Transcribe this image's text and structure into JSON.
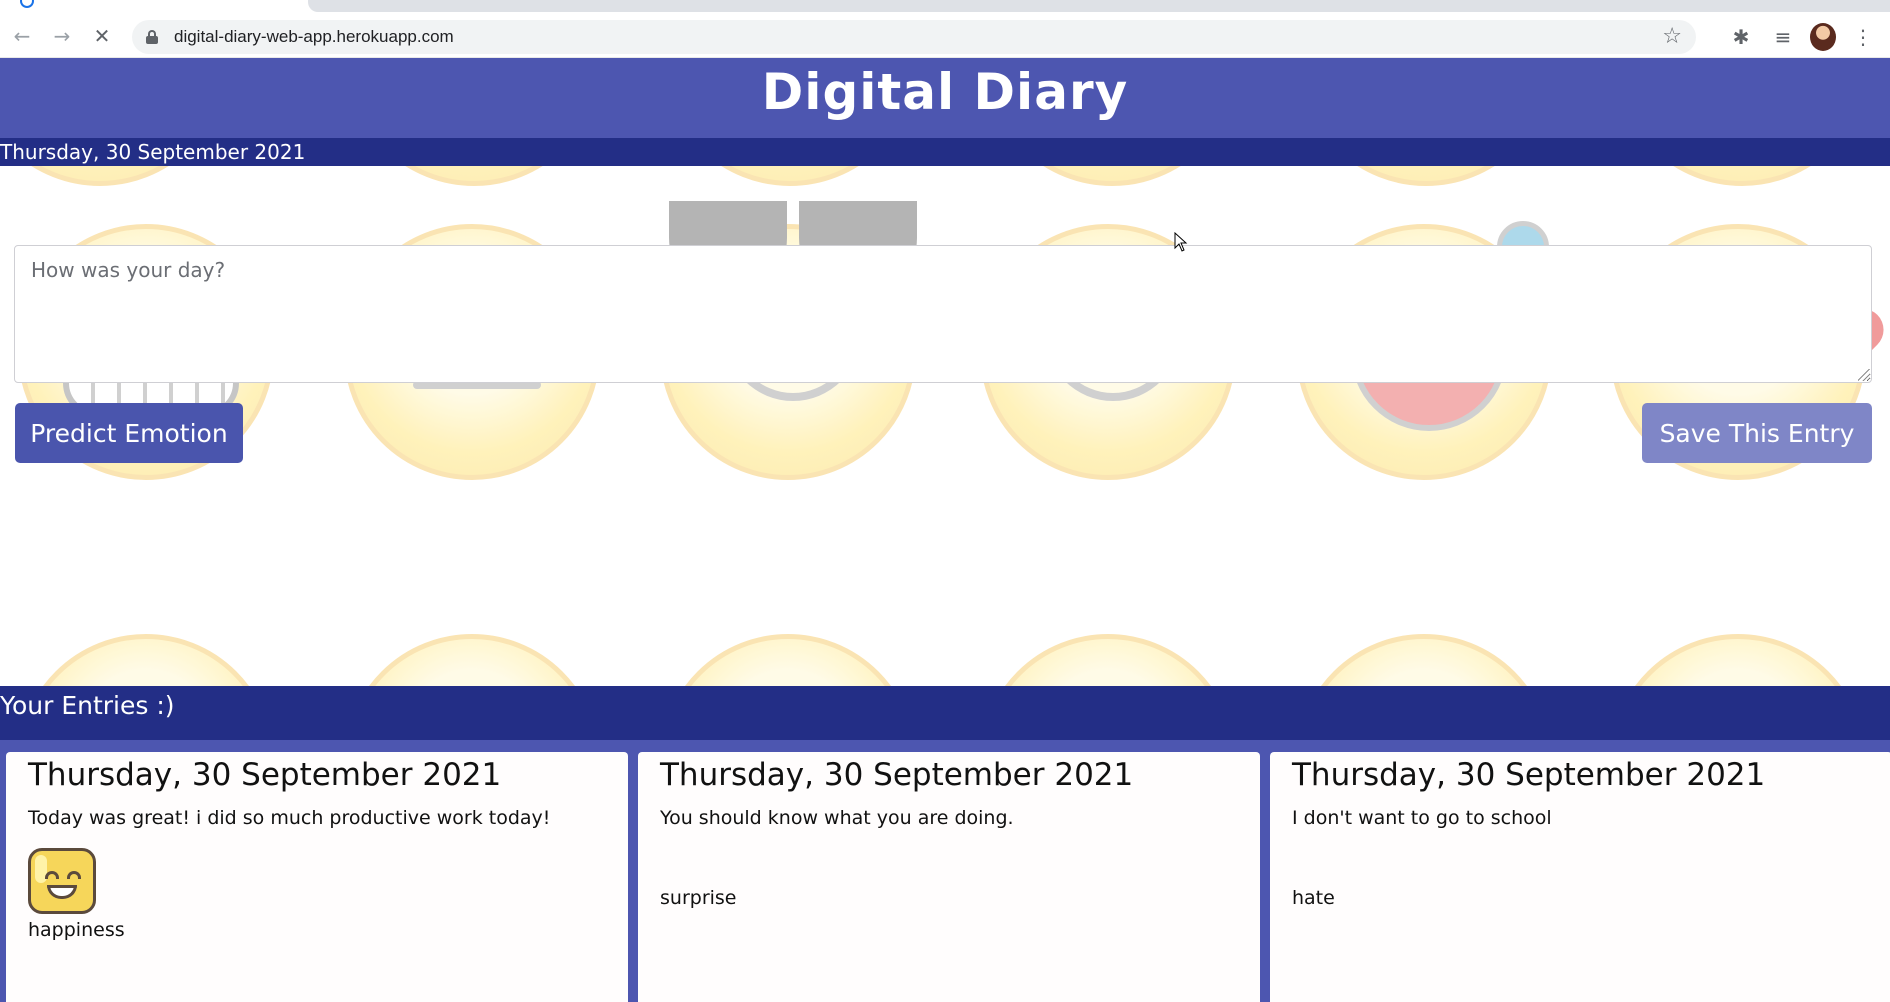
{
  "browser": {
    "url": "digital-diary-web-app.herokuapp.com",
    "icons": {
      "back": "back-arrow-icon",
      "forward": "forward-arrow-icon",
      "stop": "stop-loading-icon",
      "bookmark": "star-icon",
      "extensions": "puzzle-icon",
      "media": "media-queue-icon",
      "menu": "more-vert-icon"
    }
  },
  "app": {
    "title": "Digital Diary",
    "date": "Thursday, 30 September 2021",
    "colors": {
      "header": "#4d56b0",
      "strip": "#232e86",
      "button": "#4a55ad"
    }
  },
  "form": {
    "placeholder": "How was your day?",
    "predict_label": "Predict Emotion",
    "save_label": "Save This Entry"
  },
  "entries": {
    "heading": "Your Entries :)",
    "items": [
      {
        "date": "Thursday, 30 September 2021",
        "text": "Today was great! i did so much productive work today!",
        "emotion": "happiness"
      },
      {
        "date": "Thursday, 30 September 2021",
        "text": "You should know what you are doing.",
        "emotion": "surprise"
      },
      {
        "date": "Thursday, 30 September 2021",
        "text": "I don't want to go to school",
        "emotion": "hate"
      }
    ]
  }
}
